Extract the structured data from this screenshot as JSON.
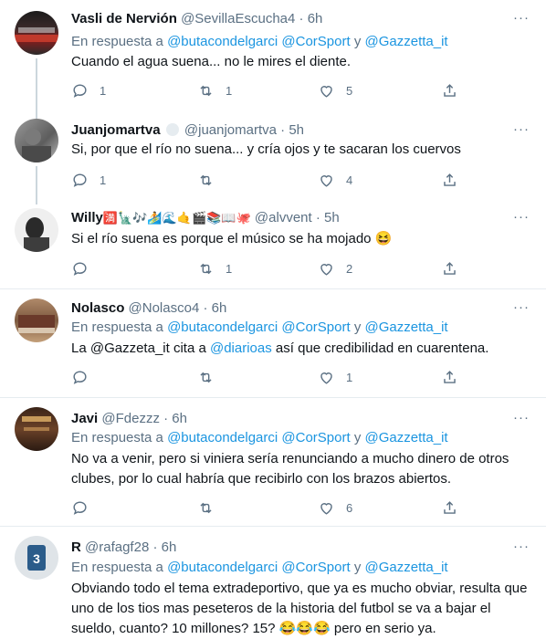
{
  "tweets": [
    {
      "name": "Vasli de Nervión",
      "handle": "@SevillaEscucha4",
      "time": "6h",
      "reply_prefix": "En respuesta a",
      "reply_user1": "@butacondelgarci",
      "reply_user2": "@CorSport",
      "reply_and": "y",
      "reply_user3": "@Gazzetta_it",
      "text": "Cuando el agua suena... no le mires el diente.",
      "replies": "1",
      "retweets": "1",
      "likes": "5"
    },
    {
      "name": "Juanjomartva",
      "handle": "@juanjomartva",
      "time": "5h",
      "text": "Si, por que el río no suena... y cría ojos y te sacaran los cuervos",
      "replies": "1",
      "retweets": "",
      "likes": "4"
    },
    {
      "name": "Willy",
      "name_emojis": "🈵🗽🎶🏄🌊🤙🎬📚📖🐙",
      "handle": "@alvvent",
      "time": "5h",
      "text": "Si el río suena es porque el músico se ha mojado",
      "text_emoji": "😆",
      "replies": "",
      "retweets": "1",
      "likes": "2"
    },
    {
      "name": "Nolasco",
      "handle": "@Nolasco4",
      "time": "6h",
      "reply_prefix": "En respuesta a",
      "reply_user1": "@butacondelgarci",
      "reply_user2": "@CorSport",
      "reply_and": "y",
      "reply_user3": "@Gazzetta_it",
      "text_pre": "La @Gazzeta_it cita a",
      "text_link": "@diarioas",
      "text_post": "así que credibilidad en cuarentena.",
      "replies": "",
      "retweets": "",
      "likes": "1"
    },
    {
      "name": "Javi",
      "handle": "@Fdezzz",
      "time": "6h",
      "reply_prefix": "En respuesta a",
      "reply_user1": "@butacondelgarci",
      "reply_user2": "@CorSport",
      "reply_and": "y",
      "reply_user3": "@Gazzetta_it",
      "text_line1": "No va a venir, pero si viniera sería renunciando a mucho dinero de otros",
      "text_line2": "clubes, por lo cual habría que recibirlo con los brazos abiertos.",
      "replies": "",
      "retweets": "",
      "likes": "6"
    },
    {
      "name": "R",
      "handle": "@rafagf28",
      "time": "6h",
      "reply_prefix": "En respuesta a",
      "reply_user1": "@butacondelgarci",
      "reply_user2": "@CorSport",
      "reply_and": "y",
      "reply_user3": "@Gazzetta_it",
      "text_line1": "Obviando todo el tema extradeportivo, que ya es mucho obviar, resulta que",
      "text_line2": "uno de los tios mas peseteros de la historia del futbol se va a bajar el",
      "text_line3": "sueldo, cuanto? 10 millones? 15?",
      "text_emojis": "😂😂😂",
      "text_line3_end": "pero en serio ya."
    }
  ],
  "more_glyph": "···",
  "dot": "·",
  "colors": {
    "link": "#1b95e0",
    "muted": "#5b7083",
    "text": "#0f1419",
    "separator": "#e6ecf0"
  }
}
